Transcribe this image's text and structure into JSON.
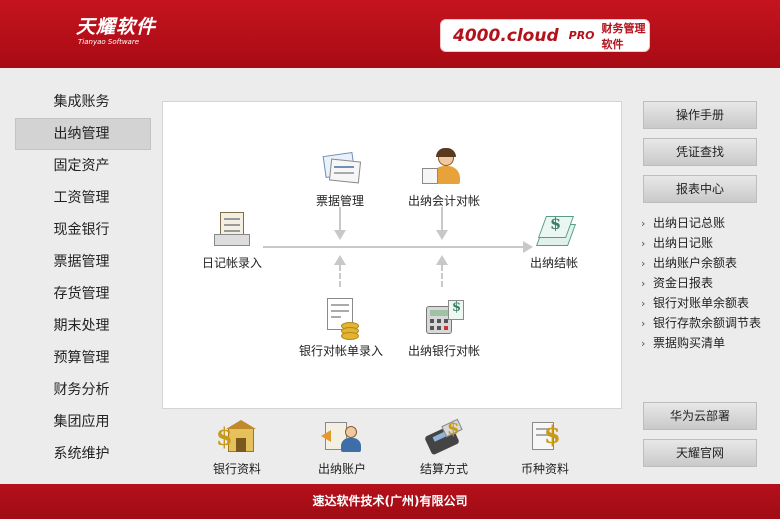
{
  "header": {
    "logo_cn": "天耀软件",
    "logo_en": "Tianyao Software",
    "product": "4000.cloud",
    "edition": "PRO",
    "product_cn": "财务管理软件"
  },
  "nav": {
    "items": [
      {
        "label": "集成账务"
      },
      {
        "label": "出纳管理",
        "active": true
      },
      {
        "label": "固定资产"
      },
      {
        "label": "工资管理"
      },
      {
        "label": "现金银行"
      },
      {
        "label": "票据管理"
      },
      {
        "label": "存货管理"
      },
      {
        "label": "期末处理"
      },
      {
        "label": "预算管理"
      },
      {
        "label": "财务分析"
      },
      {
        "label": "集团应用"
      },
      {
        "label": "系统维护"
      }
    ]
  },
  "flow": {
    "journal_entry": "日记帐录入",
    "bill_mgmt": "票据管理",
    "cashier_reconcile": "出纳会计对帐",
    "cashier_close": "出纳结帐",
    "bank_statement_entry": "银行对帐单录入",
    "cashier_bank_reconcile": "出纳银行对帐"
  },
  "bottom": {
    "bank_info": "银行资料",
    "cashier_account": "出纳账户",
    "settlement_method": "结算方式",
    "currency_info": "币种资料"
  },
  "right": {
    "manual": "操作手册",
    "voucher_search": "凭证查找",
    "report_center": "报表中心",
    "reports": [
      "出纳日记总账",
      "出纳日记账",
      "出纳账户余额表",
      "资金日报表",
      "银行对账单余额表",
      "银行存款余额调节表",
      "票据购买清单"
    ],
    "huawei": "华为云部署",
    "official_site": "天耀官网"
  },
  "footer": {
    "company": "速达软件技术(广州)有限公司"
  },
  "colors": {
    "brand_red": "#b3121c",
    "panel_bg": "#ececec"
  }
}
